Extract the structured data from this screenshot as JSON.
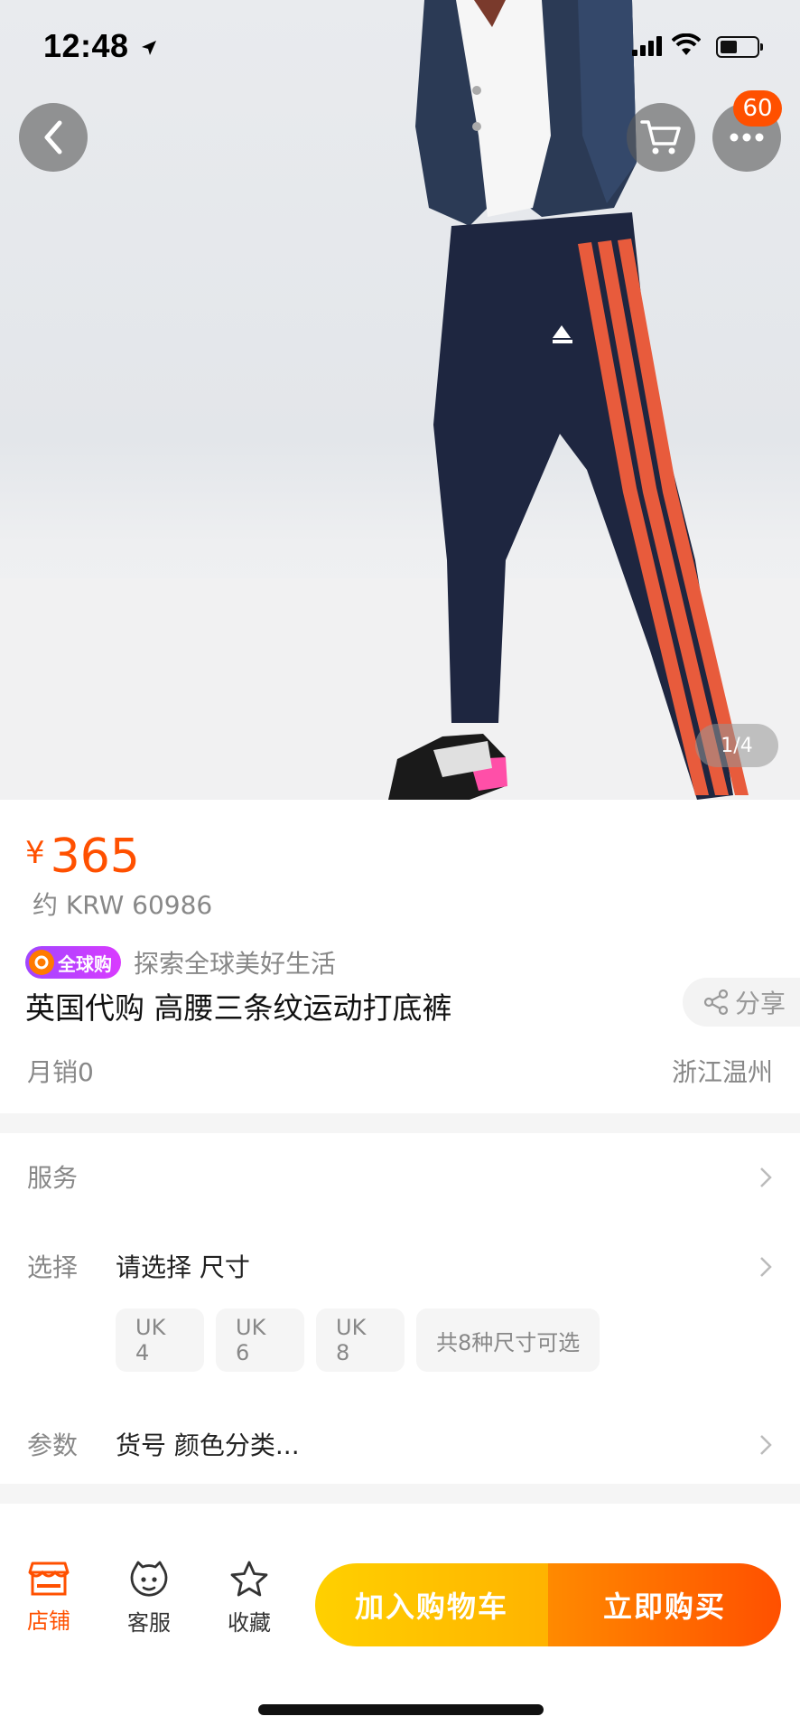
{
  "status_bar": {
    "time": "12:48"
  },
  "hero": {
    "cart_badge": "60",
    "pager": "1/4"
  },
  "product": {
    "price_symbol": "¥",
    "price": "365",
    "approx_price": "约 KRW 60986",
    "global_tag": "全球购",
    "slogan": "探索全球美好生活",
    "title": "英国代购 高腰三条纹运动打底裤",
    "share_label": "分享",
    "monthly_sales": "月销0",
    "location": "浙江温州"
  },
  "options": {
    "service_label": "服务",
    "select_label": "选择",
    "select_value": "请选择 尺寸",
    "sizes": [
      "UK 4",
      "UK 6",
      "UK 8",
      "共8种尺寸可选"
    ],
    "params_label": "参数",
    "params_value": "货号 颜色分类..."
  },
  "bottom_bar": {
    "shop_label": "店铺",
    "service_label": "客服",
    "favorite_label": "收藏",
    "add_to_cart": "加入购物车",
    "buy_now": "立即购买"
  },
  "colors": {
    "accent": "#ff5000",
    "cart_button": "#ffc000",
    "tag_purple": "#b23cff"
  },
  "icons": [
    "back-icon",
    "cart-icon",
    "more-icon",
    "share-icon",
    "chevron-right-icon",
    "shop-icon",
    "customer-service-icon",
    "star-icon"
  ]
}
